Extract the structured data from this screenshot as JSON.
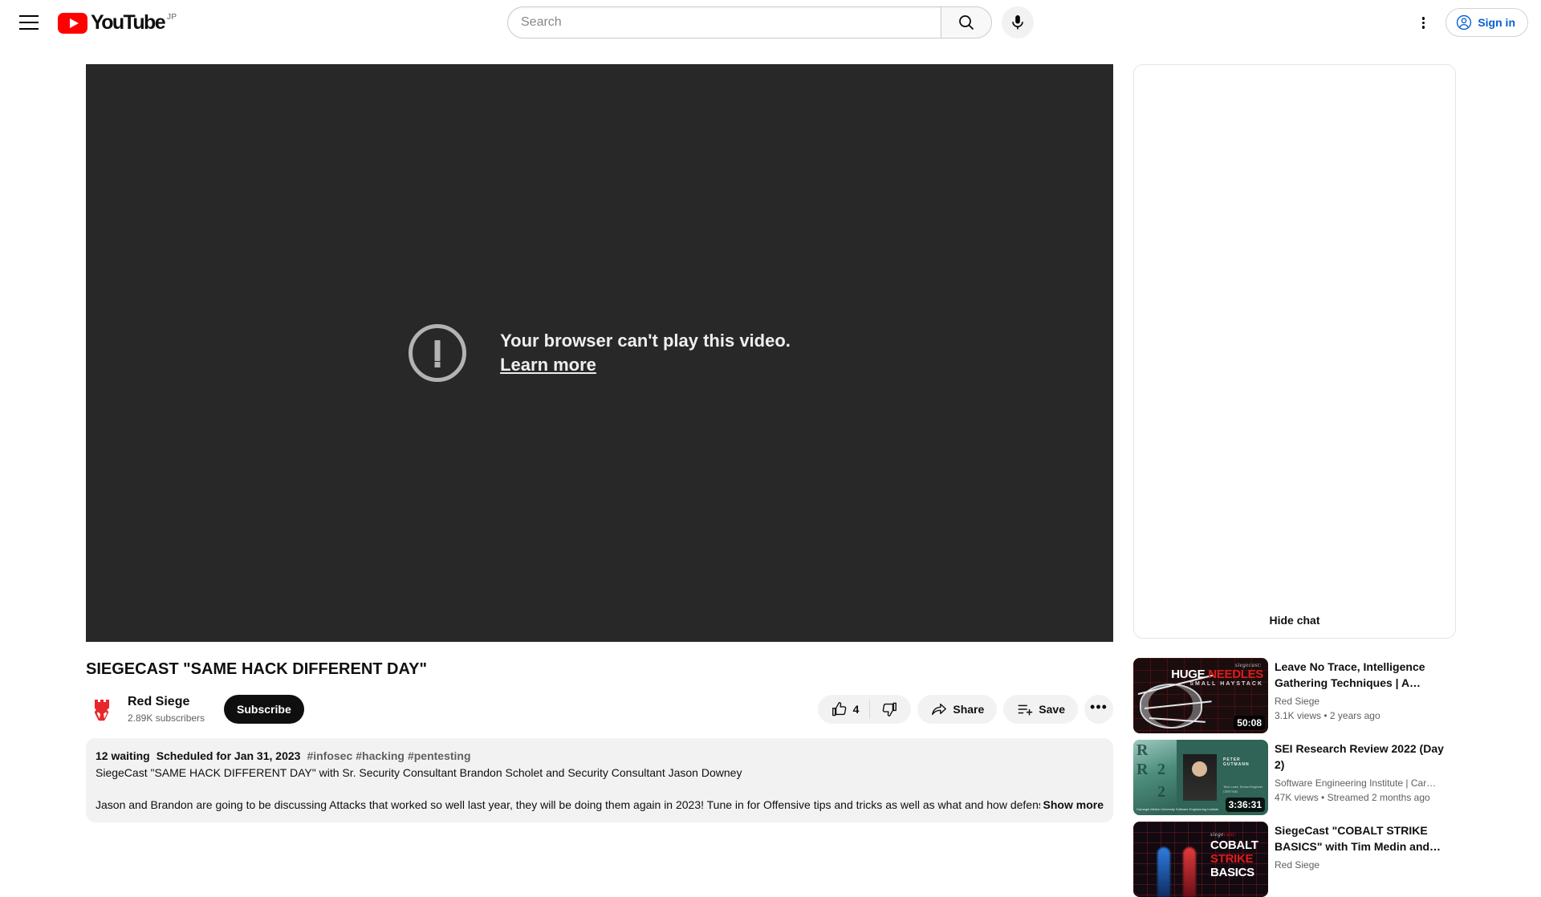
{
  "masthead": {
    "menu_label": "Guide",
    "logo_text": "YouTube",
    "country_code": "JP",
    "search": {
      "placeholder": "Search",
      "value": ""
    },
    "search_button_label": "Search",
    "mic_button_label": "Search with your voice",
    "settings_label": "Settings",
    "signin_label": "Sign in"
  },
  "player": {
    "error_title": "Your browser can't play this video.",
    "error_link": "Learn more",
    "background_color": "#282828"
  },
  "video": {
    "title": "SIEGECAST \"SAME HACK DIFFERENT DAY\"",
    "channel": {
      "name": "Red Siege",
      "subscribers": "2.89K subscribers"
    },
    "subscribe_label": "Subscribe",
    "actions": {
      "like_count": "4",
      "like_label": "Like",
      "dislike_label": "Dislike",
      "share_label": "Share",
      "save_label": "Save",
      "more_label": "More actions"
    },
    "description": {
      "waiting": "12 waiting",
      "scheduled": "Scheduled for Jan 31, 2023",
      "hashtags": [
        "#infosec",
        "#hacking",
        "#pentesting"
      ],
      "line2": "SiegeCast \"SAME HACK DIFFERENT DAY\" with Sr. Security Consultant Brandon Scholet and Security Consultant Jason Downey",
      "body": "Jason and Brandon are going to be discussing Attacks that worked so well last year, they will be doing them again in 2023! Tune in for Offensive tips and tricks as well as what and how defense",
      "show_more": "Show more"
    }
  },
  "chat": {
    "hide_chat_label": "Hide chat"
  },
  "recommendations": [
    {
      "title": "Leave No Trace, Intelligence Gathering Techniques | A…",
      "channel": "Red Siege",
      "views": "3.1K views",
      "age": "2 years ago",
      "duration": "50:08",
      "thumb_line1": "siegecast:",
      "thumb_line2_a": "HUGE ",
      "thumb_line2_b": "NEEDLES",
      "thumb_line3": "SMALL HAYSTACK"
    },
    {
      "title": "SEI Research Review 2022 (Day 2)",
      "channel": "Software Engineering Institute | Car…",
      "views": "47K views",
      "age": "Streamed 2 months ago",
      "duration": "3:36:31",
      "thumb_name": "PETER GUTMANN",
      "thumb_role": "Tech Lead, Senior Engineer\nCERT/SEI",
      "thumb_foot": "Carnegie Mellon University\nSoftware Engineering Institute",
      "thumb_rr": "2"
    },
    {
      "title": "SiegeCast \"COBALT STRIKE BASICS\" with Tim Medin and…",
      "channel": "Red Siege",
      "views": "",
      "age": "",
      "duration": "",
      "thumb_line1_a": "siege",
      "thumb_line1_b": "cast:",
      "thumb_line2": "COBALT",
      "thumb_line3": "STRIKE",
      "thumb_line4": "BASICS"
    }
  ],
  "colors": {
    "accent_blue": "#065fd4",
    "brand_red": "#ff0000",
    "text_primary": "#0f0f0f",
    "text_secondary": "#606060"
  }
}
